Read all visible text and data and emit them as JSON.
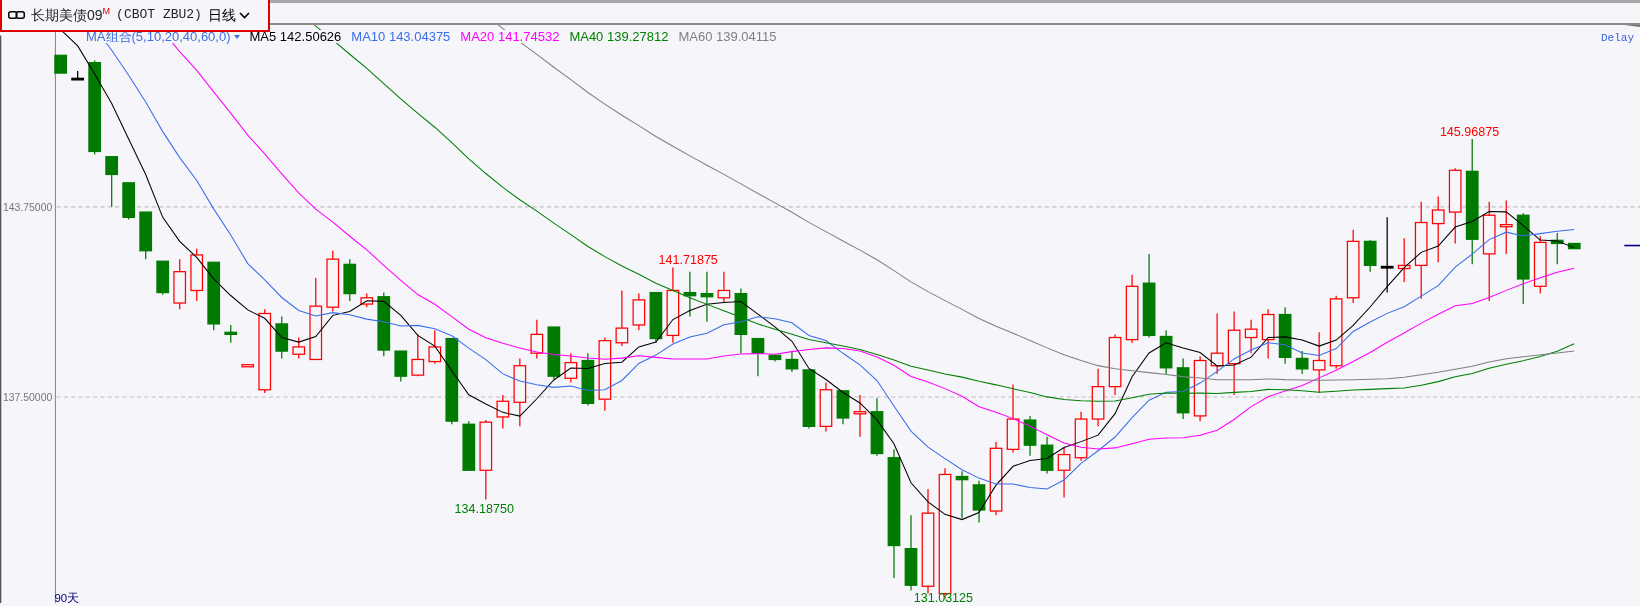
{
  "header": {
    "title": "长期美债09",
    "badge": "M",
    "code": "(CBOT ZBU2)",
    "period": "日线"
  },
  "legend": [
    {
      "label": "MA组合(5,10,20,40,60,0)",
      "color": "#3d6fe0"
    },
    {
      "label": "MA5 142.50626",
      "color": "#000000"
    },
    {
      "label": "MA10 143.04375",
      "color": "#3a6ee8"
    },
    {
      "label": "MA20 141.74532",
      "color": "#ff00ff"
    },
    {
      "label": "MA40 139.27812",
      "color": "#008000"
    },
    {
      "label": "MA60 139.04115",
      "color": "#808080"
    }
  ],
  "delay": "Delay",
  "chart": {
    "yticks": [
      "143.75000",
      "137.50000"
    ],
    "annotations": [
      {
        "text": "145.96875",
        "color": "#ff0000"
      },
      {
        "text": "141.71875",
        "color": "#ff0000"
      },
      {
        "text": "134.18750",
        "color": "#008000"
      },
      {
        "text": "131.03125",
        "color": "#008000"
      }
    ],
    "range": "90天"
  }
}
